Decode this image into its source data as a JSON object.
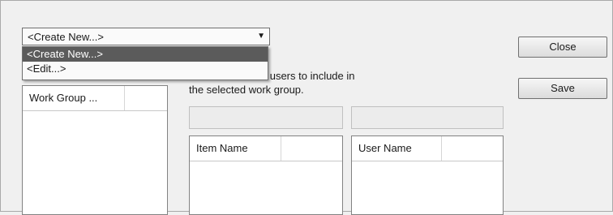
{
  "combo": {
    "selected": "<Create New...>"
  },
  "dropdown": {
    "options": [
      "<Create New...>",
      "<Edit...>"
    ]
  },
  "description": {
    "line1": "Select items and users to include in",
    "line2": "the selected work group."
  },
  "buttons": {
    "close": "Close",
    "save": "Save"
  },
  "lists": {
    "work_group_header": "Work Group ...",
    "item_name_header": "Item Name",
    "user_name_header": "User Name"
  },
  "icons": {
    "combo_arrow": "chevron-down-icon"
  }
}
